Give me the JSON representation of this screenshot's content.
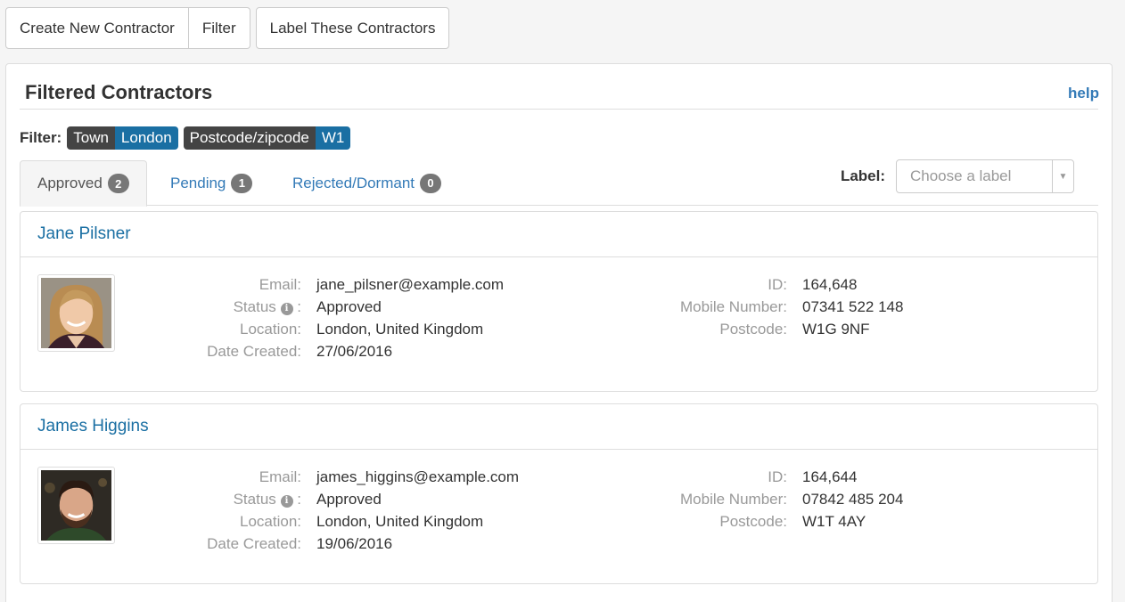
{
  "toolbar": {
    "create_label": "Create New Contractor",
    "filter_label": "Filter",
    "label_these_label": "Label These Contractors"
  },
  "panel": {
    "title": "Filtered Contractors",
    "help": "help"
  },
  "filter": {
    "label": "Filter:",
    "chips": [
      {
        "key": "Town",
        "value": "London"
      },
      {
        "key": "Postcode/zipcode",
        "value": "W1"
      }
    ]
  },
  "tabs": [
    {
      "label": "Approved",
      "count": "2",
      "active": true
    },
    {
      "label": "Pending",
      "count": "1",
      "active": false
    },
    {
      "label": "Rejected/Dormant",
      "count": "0",
      "active": false
    }
  ],
  "label_select": {
    "label": "Label:",
    "placeholder": "Choose a label"
  },
  "field_labels": {
    "email": "Email:",
    "status": "Status",
    "status_colon": ":",
    "location": "Location:",
    "date_created": "Date Created:",
    "id": "ID:",
    "mobile": "Mobile Number:",
    "postcode": "Postcode:"
  },
  "contractors": [
    {
      "name": "Jane Pilsner",
      "email": "jane_pilsner@example.com",
      "status": "Approved",
      "location": "London, United Kingdom",
      "date_created": "27/06/2016",
      "id": "164,648",
      "mobile": "07341 522 148",
      "postcode": "W1G 9NF"
    },
    {
      "name": "James Higgins",
      "email": "james_higgins@example.com",
      "status": "Approved",
      "location": "London, United Kingdom",
      "date_created": "19/06/2016",
      "id": "164,644",
      "mobile": "07842 485 204",
      "postcode": "W1T 4AY"
    }
  ],
  "colors": {
    "link": "#337ab7",
    "chip_key": "#444444",
    "chip_value": "#1a6fa3",
    "badge": "#777777"
  }
}
